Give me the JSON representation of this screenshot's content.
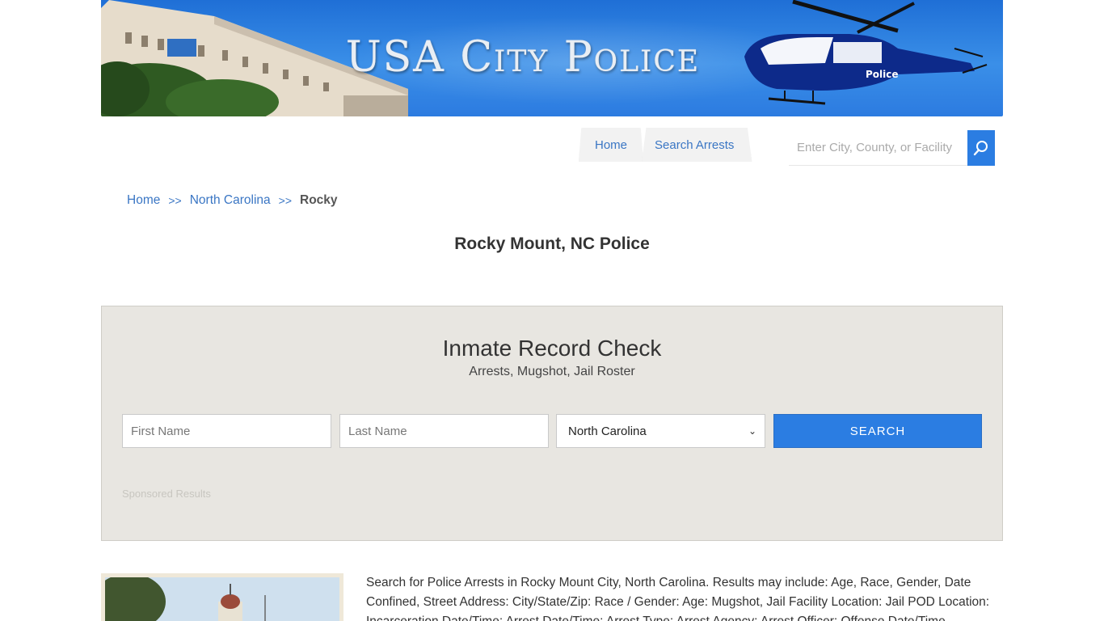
{
  "banner": {
    "title": "USA City Police"
  },
  "nav": {
    "home": "Home",
    "search_arrests": "Search Arrests"
  },
  "site_search": {
    "placeholder": "Enter City, County, or Facility"
  },
  "breadcrumb": {
    "home": "Home",
    "sep": ">>",
    "state": "North Carolina",
    "current": "Rocky"
  },
  "page_title": "Rocky Mount, NC Police",
  "inmate_check": {
    "heading": "Inmate Record Check",
    "subheading": "Arrests, Mugshot, Jail Roster",
    "first_name_placeholder": "First Name",
    "last_name_placeholder": "Last Name",
    "state_selected": "North Carolina",
    "search_label": "SEARCH",
    "sponsored": "Sponsored Results"
  },
  "description": "Search for Police Arrests in Rocky Mount City, North Carolina. Results may include: Age, Race, Gender, Date Confined, Street Address: City/State/Zip: Race / Gender: Age: Mugshot, Jail Facility Location: Jail POD Location: Incarceration Date/Time: Arrest Date/Time: Arrest Type: Arrest Agency: Arrest Officer: Offense Date/Time"
}
